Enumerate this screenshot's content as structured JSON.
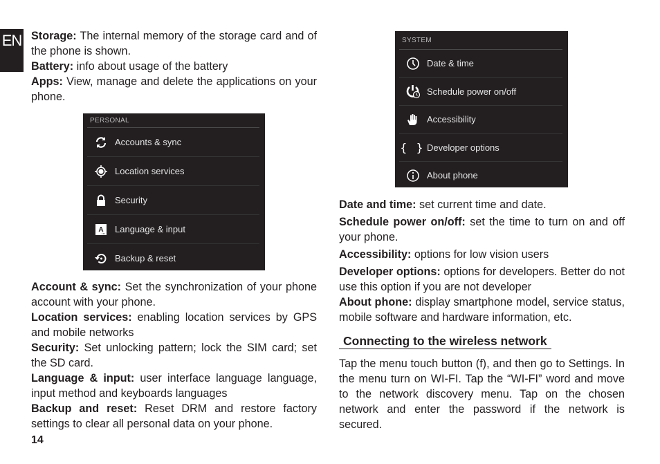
{
  "language_tab": "EN",
  "page_number": "14",
  "intro": [
    {
      "term": "Storage:",
      "text": " The internal memory of the storage card and of the phone is shown."
    },
    {
      "term": "Battery:",
      "text": " info about usage of the battery"
    },
    {
      "term": "Apps:",
      "text": " View, manage and delete the applications on your phone."
    }
  ],
  "personal_screenshot": {
    "header": "PERSONAL",
    "items": [
      {
        "label": "Accounts & sync",
        "icon": "sync-icon"
      },
      {
        "label": "Location services",
        "icon": "location-icon"
      },
      {
        "label": "Security",
        "icon": "lock-icon"
      },
      {
        "label": "Language & input",
        "icon": "language-icon"
      },
      {
        "label": "Backup & reset",
        "icon": "backup-icon"
      }
    ]
  },
  "personal_desc": [
    {
      "term": "Account & sync:",
      "text": " Set the synchronization of your phone account with your phone."
    },
    {
      "term": "Location services:",
      "text": " enabling location services by GPS and mobile networks"
    },
    {
      "term": "Security:",
      "text": " Set unlocking pattern; lock the SIM card; set the SD card."
    },
    {
      "term": "Language & input:",
      "text": " user interface language language, input method and keyboards languages"
    },
    {
      "term": "Backup and reset:",
      "text": " Reset DRM and restore factory settings to clear all personal data on your phone."
    }
  ],
  "system_screenshot": {
    "header": "SYSTEM",
    "items": [
      {
        "label": "Date & time",
        "icon": "clock-icon"
      },
      {
        "label": "Schedule power on/off",
        "icon": "power-schedule-icon"
      },
      {
        "label": "Accessibility",
        "icon": "hand-icon"
      },
      {
        "label": "Developer options",
        "icon": "braces-icon"
      },
      {
        "label": "About phone",
        "icon": "info-icon"
      }
    ]
  },
  "system_desc": [
    {
      "term": "Date and time:",
      "text": " set current time and date."
    },
    {
      "term": "Schedule power on/off:",
      "text": " set the time to turn on and off your phone."
    },
    {
      "term": "Accessibility:",
      "text": " options for low vision users"
    },
    {
      "term": "Developer options:",
      "text": " options for developers. Better do not use this option if you are not developer"
    },
    {
      "term": "About phone:",
      "text": " display smartphone model, service status, mobile software and hardware information, etc."
    }
  ],
  "wireless": {
    "heading": "Connecting to the wireless network",
    "body": "Tap the menu touch button (f), and then go to Settings. In the menu turn on WI-FI. Tap the “WI-FI” word and move to the network discovery menu. Tap on the chosen network and enter the password if the network is secured."
  }
}
